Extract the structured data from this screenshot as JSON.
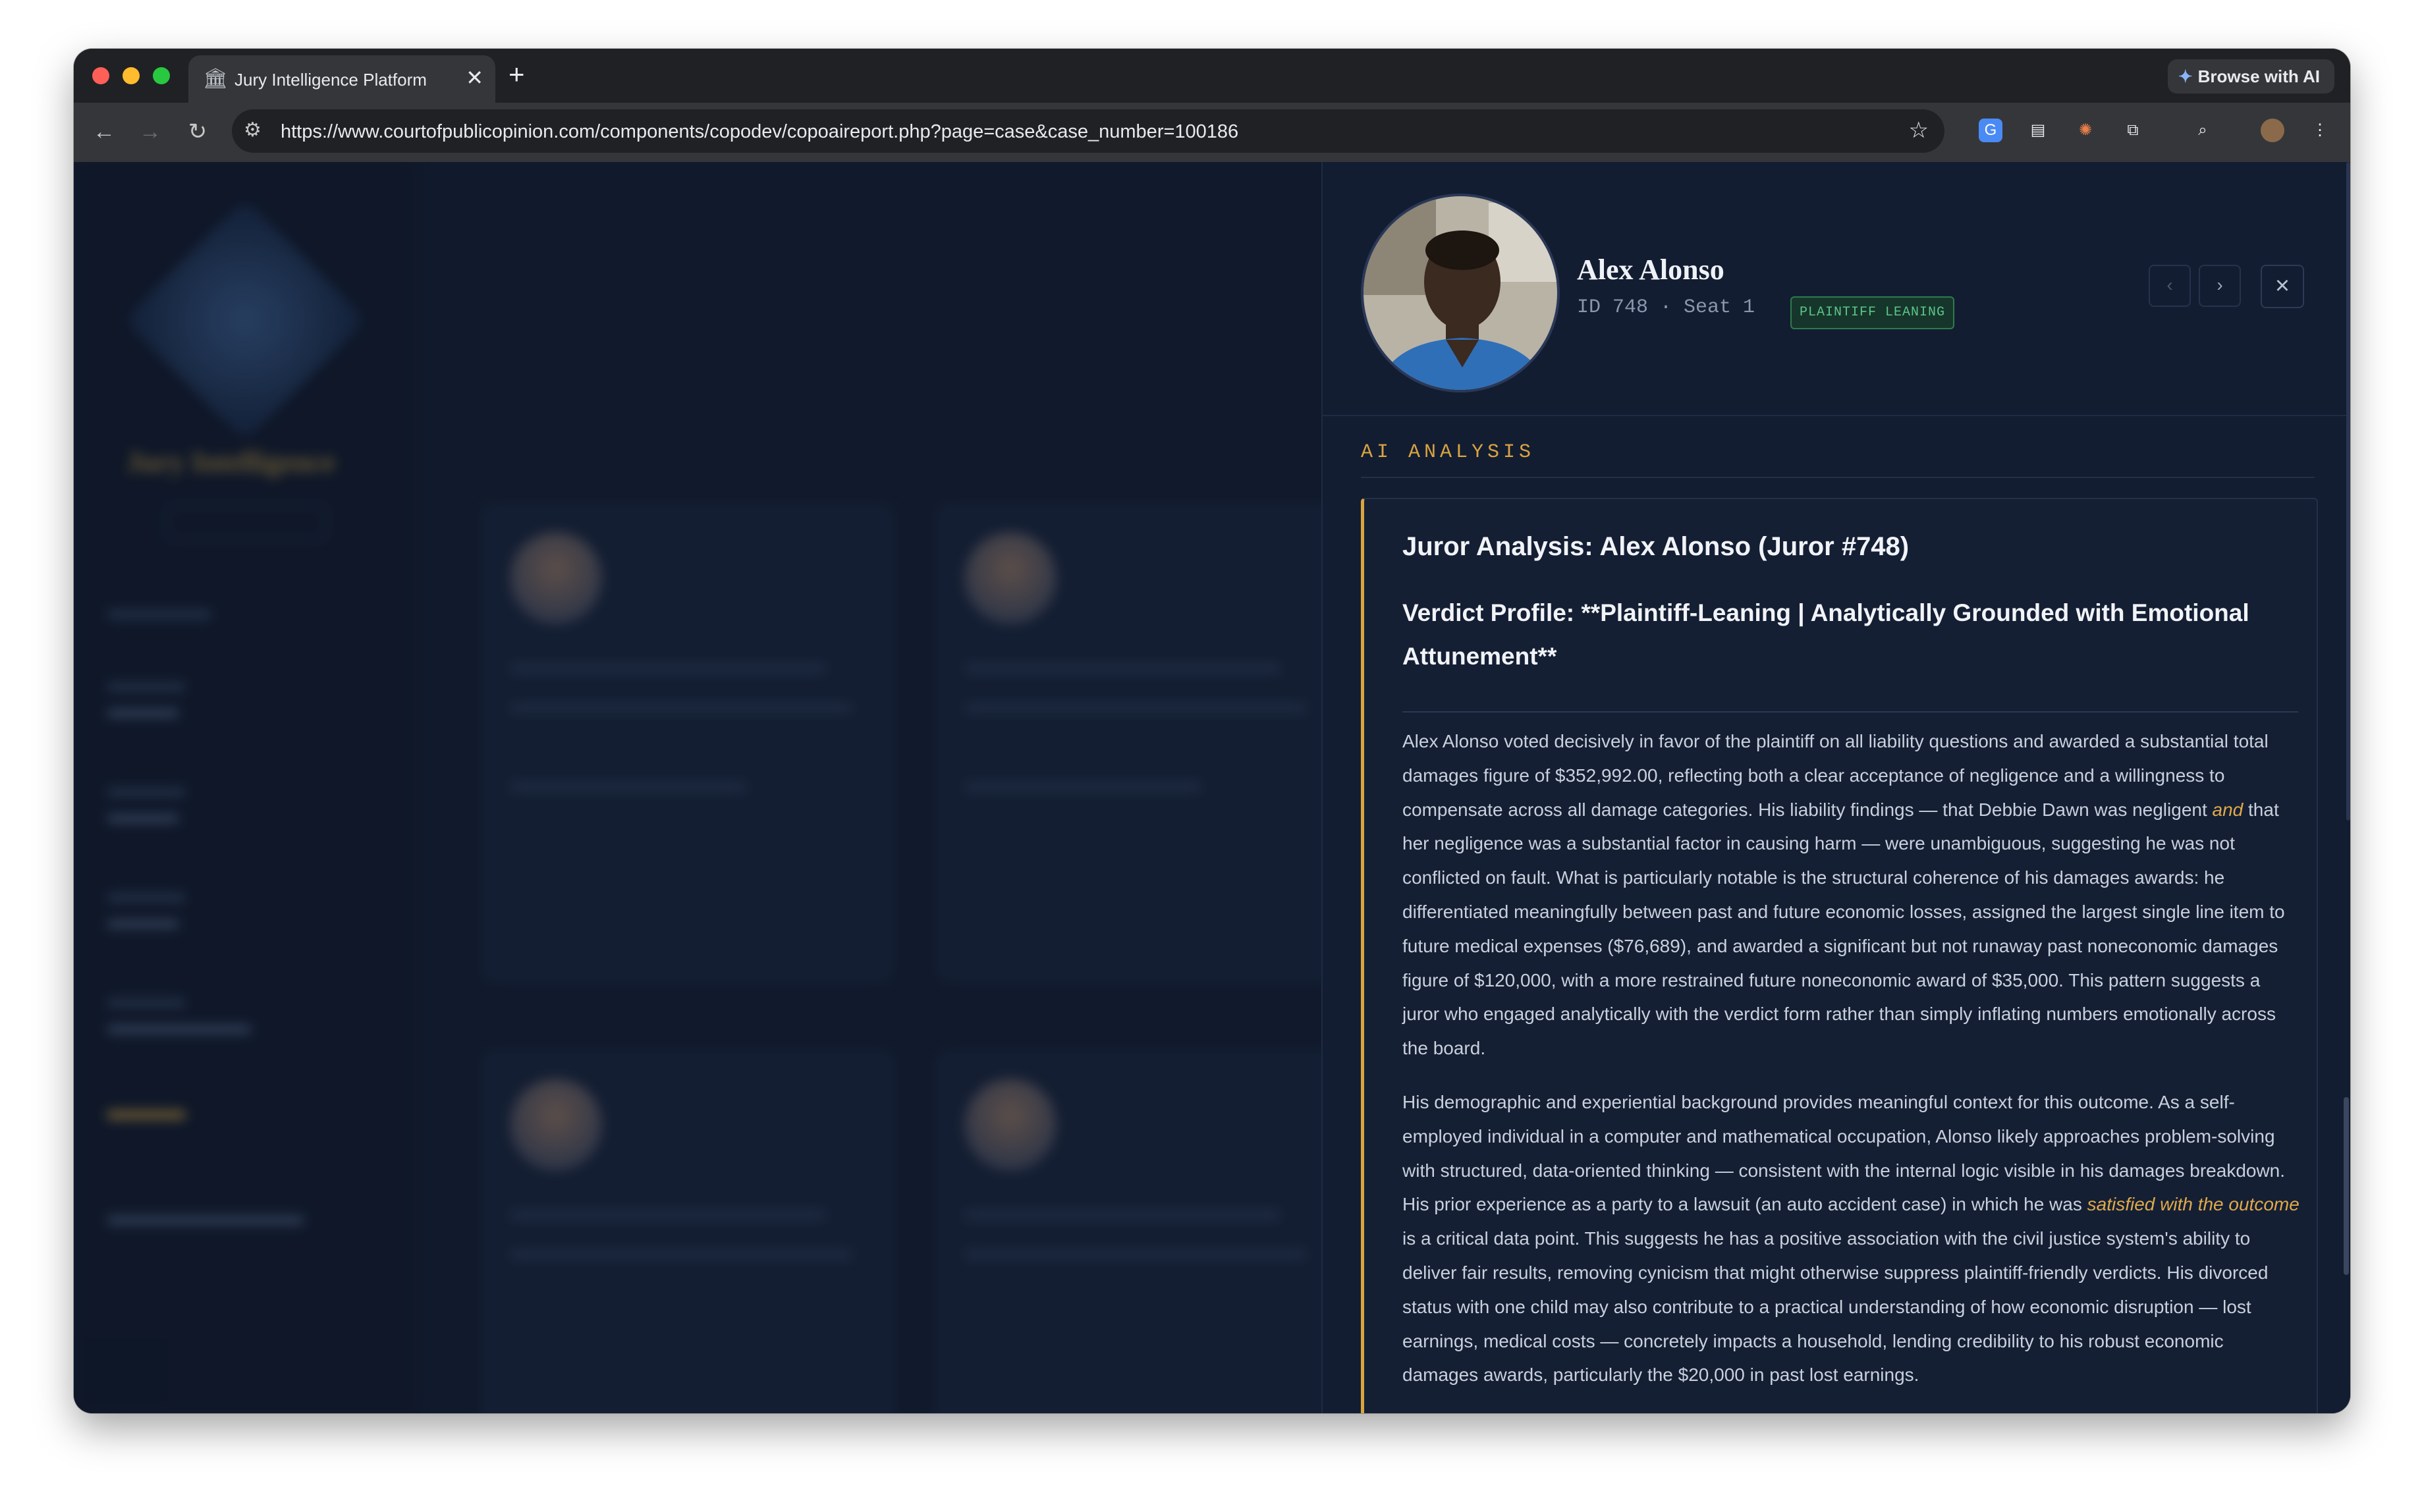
{
  "browser": {
    "tab_title": "Jury Intelligence Platform",
    "tab_icon": "bank-icon",
    "url": "https://www.courtofpublicopinion.com/components/copodev/copoaireport.php?page=case&case_number=100186",
    "browse_ai_label": "Browse with AI"
  },
  "juror": {
    "name": "Alex Alonso",
    "meta": "ID 748 · Seat 1",
    "badge": "PLAINTIFF LEANING"
  },
  "section": {
    "title": "AI ANALYSIS"
  },
  "analysis": {
    "title": "Juror Analysis: Alex Alonso (Juror #748)",
    "subtitle": "Verdict Profile: **Plaintiff-Leaning | Analytically Grounded with Emotional Attunement**",
    "p1_a": "Alex Alonso voted decisively in favor of the plaintiff on all liability questions and awarded a substantial total damages figure of $352,992.00, reflecting both a clear acceptance of negligence and a willingness to compensate across all damage categories. His liability findings — that Debbie Dawn was negligent ",
    "p1_em": "and",
    "p1_b": " that her negligence was a substantial factor in causing harm — were unambiguous, suggesting he was not conflicted on fault. What is particularly notable is the structural coherence of his damages awards: he differentiated meaningfully between past and future economic losses, assigned the largest single line item to future medical expenses ($76,689), and awarded a significant but not runaway past noneconomic damages figure of $120,000, with a more restrained future noneconomic award of $35,000. This pattern suggests a juror who engaged analytically with the verdict form rather than simply inflating numbers emotionally across the board.",
    "p2_a": "His demographic and experiential background provides meaningful context for this outcome. As a self-employed individual in a computer and mathematical occupation, Alonso likely approaches problem-solving with structured, data-oriented thinking — consistent with the internal logic visible in his damages breakdown. His prior experience as a party to a lawsuit (an auto accident case) in which he was ",
    "p2_em": "satisfied with the outcome",
    "p2_b": " is a critical data point. This suggests he has a positive association with the civil justice system's ability to deliver fair results, removing cynicism that might otherwise suppress plaintiff-friendly verdicts. His divorced status with one child may also contribute to a practical understanding of how economic disruption — lost earnings, medical costs — concretely impacts a household, lending credibility to his robust economic damages awards, particularly the $20,000 in past lost earnings."
  },
  "background": {
    "app_title": "Jury Intelligence"
  },
  "colors": {
    "accent": "#d9a441",
    "badge_green": "#5cc58a",
    "panel_bg": "#131d31"
  }
}
